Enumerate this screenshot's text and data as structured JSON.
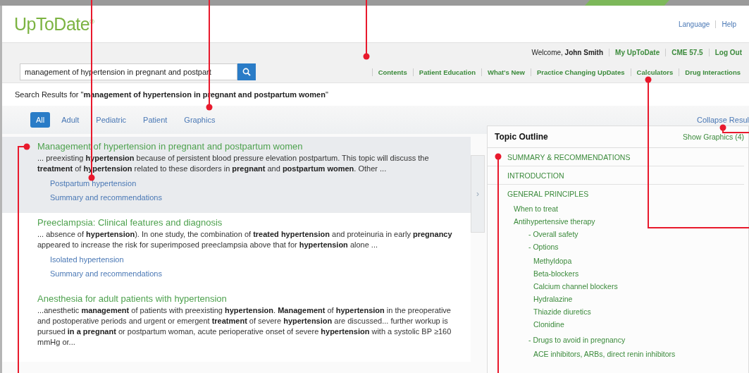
{
  "header": {
    "logo": "UpToDate",
    "logo_mark": "®",
    "links": [
      "Language",
      "Help"
    ]
  },
  "account_bar": {
    "welcome": "Welcome, **John Smith**",
    "links": [
      "My UpToDate",
      "CME 57.5",
      "Log Out"
    ]
  },
  "search": {
    "value": "management of hypertension in pregnant and postpart"
  },
  "nav": [
    "Contents",
    "Patient Education",
    "What's New",
    "Practice Changing UpDates",
    "Calculators",
    "Drug Interactions"
  ],
  "results_heading": "Search Results for \"**management of hypertension in pregnant and postpartum women**\"",
  "filters": [
    {
      "label": "All",
      "selected": true
    },
    {
      "label": "Adult",
      "selected": false
    },
    {
      "label": "Pediatric",
      "selected": false
    },
    {
      "label": "Patient",
      "selected": false
    },
    {
      "label": "Graphics",
      "selected": false
    }
  ],
  "collapse_link": "Collapse Resul",
  "handle": "›",
  "results": [
    {
      "title": "Management of hypertension in pregnant and postpartum women",
      "selected": true,
      "snippet": "... preexisting **hypertension** because of persistent blood pressure elevation postpartum. This topic will discuss the **treatment** of **hypertension** related to these disorders in **pregnant** and **postpartum women**. Other ...",
      "links": [
        "Postpartum hypertension",
        "Summary and recommendations"
      ]
    },
    {
      "title": "Preeclampsia: Clinical features and diagnosis",
      "selected": false,
      "snippet": "... absence of **hypertension**). In one study, the combination of **treated hypertension** and proteinuria in early **pregnancy** appeared to increase the risk for superimposed preeclampsia above that for **hypertension** alone ...",
      "links": [
        "Isolated hypertension",
        "Summary and recommendations"
      ]
    },
    {
      "title": "Anesthesia for adult patients with hypertension",
      "selected": false,
      "snippet": "...anesthetic **management** of patients with preexisting **hypertension**. **Management** of **hypertension** in the preoperative and postoperative periods and urgent or emergent **treatment** of severe **hypertension** are discussed... further workup is pursued **in a pregnant** or postpartum woman, acute perioperative onset of severe **hypertension** with a systolic BP ≥160 mmHg or..."
    }
  ],
  "outline": {
    "title": "Topic Outline",
    "graphics_link": "Show Graphics (4)",
    "sections": [
      {
        "label": "SUMMARY & RECOMMENDATIONS"
      },
      {
        "label": "INTRODUCTION"
      },
      {
        "label": "GENERAL PRINCIPLES",
        "children": [
          {
            "label": "When to treat"
          },
          {
            "label": "Antihypertensive therapy",
            "children": [
              {
                "label": "- Overall safety"
              },
              {
                "label": "- Options",
                "children": [
                  {
                    "label": "Methyldopa"
                  },
                  {
                    "label": "Beta-blockers"
                  },
                  {
                    "label": "Calcium channel blockers"
                  },
                  {
                    "label": "Hydralazine"
                  },
                  {
                    "label": "Thiazide diuretics"
                  },
                  {
                    "label": "Clonidine"
                  }
                ]
              },
              {
                "label": "- Drugs to avoid in pregnancy",
                "children": [
                  {
                    "label": "ACE inhibitors, ARBs, direct renin inhibitors"
                  }
                ]
              }
            ]
          }
        ]
      }
    ]
  }
}
